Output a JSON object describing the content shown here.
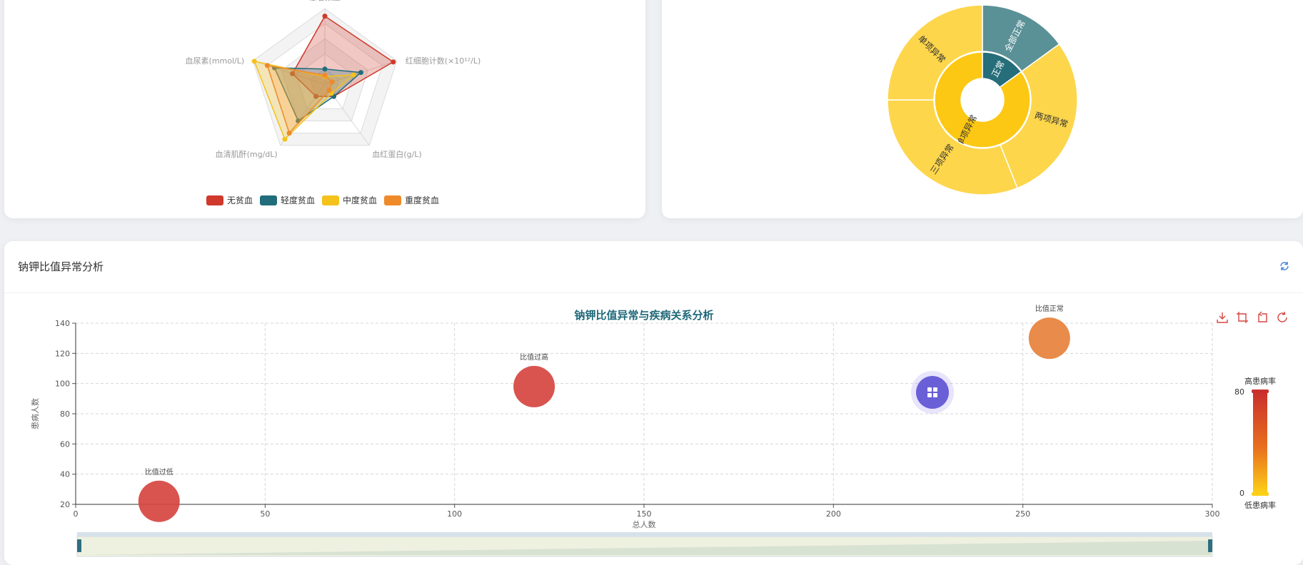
{
  "radar_card": {
    "chart_data": {
      "type": "radar",
      "indicators": [
        "患者数量",
        "红细胞计数(×10¹²/L)",
        "血红蛋白(g/L)",
        "血清肌酐(mg/dL)",
        "血尿素(mmol/L)"
      ],
      "series": [
        {
          "name": "无贫血",
          "color": "#d0392b",
          "values": [
            90,
            95,
            20,
            20,
            45
          ]
        },
        {
          "name": "轻度贫血",
          "color": "#216d7b",
          "values": [
            20,
            50,
            20,
            60,
            70
          ]
        },
        {
          "name": "中度贫血",
          "color": "#f5c21b",
          "values": [
            10,
            40,
            15,
            90,
            98
          ]
        },
        {
          "name": "重度贫血",
          "color": "#ee8a2a",
          "values": [
            12,
            10,
            10,
            80,
            80
          ]
        }
      ],
      "max": 100
    }
  },
  "sunburst_card": {
    "chart_data": {
      "type": "sunburst",
      "inner": [
        {
          "name": "正常",
          "value": 15,
          "color": "#256e7a"
        },
        {
          "name": "单项异常",
          "value": 85,
          "color": "#fcc814"
        }
      ],
      "outer": [
        {
          "name": "全部正常",
          "value": 15,
          "color": "#5a9197"
        },
        {
          "name": "两项异常",
          "value": 29,
          "color": "#fdd64b"
        },
        {
          "name": "三项异常",
          "value": 31,
          "color": "#fdd64b"
        },
        {
          "name": "单项异常",
          "value": 25,
          "color": "#fdd64b"
        }
      ]
    }
  },
  "bubble_card": {
    "title": "钠钾比值异常分析",
    "chart_data": {
      "type": "scatter",
      "title": "钠钾比值异常与疾病关系分析",
      "xlabel": "总人数",
      "ylabel": "患病人数",
      "xlim": [
        0,
        300
      ],
      "ylim": [
        20,
        140
      ],
      "xticks": [
        0,
        50,
        100,
        150,
        200,
        250,
        300
      ],
      "yticks": [
        20,
        40,
        60,
        80,
        100,
        120,
        140
      ],
      "points": [
        {
          "label": "比值过低",
          "x": 22,
          "y": 22,
          "rate": 70,
          "color": "#d64540"
        },
        {
          "label": "比值过高",
          "x": 121,
          "y": 98,
          "rate": 75,
          "color": "#d64540"
        },
        {
          "label": "比值正常",
          "x": 257,
          "y": 130,
          "rate": 50,
          "color": "#e7813b"
        }
      ],
      "visual_map": {
        "high_label": "高患病率",
        "low_label": "低患病率",
        "max": 80,
        "min": 0
      }
    }
  },
  "icons": {
    "refresh": "refresh-icon",
    "save": "save-as-image-icon",
    "zoom": "data-zoom-icon",
    "zoom_reset": "zoom-reset-icon",
    "restore": "restore-icon",
    "floating": "grid-menu-icon"
  }
}
